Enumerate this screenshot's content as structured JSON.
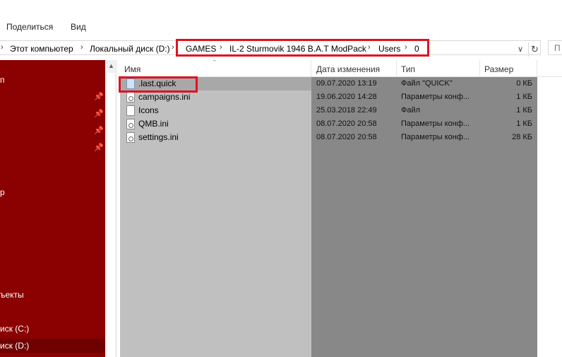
{
  "ribbon": {
    "share_label": "Поделиться",
    "view_label": "Вид"
  },
  "address": {
    "this_pc": "Этот компьютер",
    "local_disk": "Локальный диск (D:)",
    "path": [
      "GAMES",
      "IL-2 Sturmovik 1946 B.A.T ModPack",
      "Users",
      "0"
    ],
    "search_placeholder": "П"
  },
  "nav": {
    "items": [
      {
        "label": "п"
      },
      {
        "label": "р"
      },
      {
        "label": "ъекты"
      },
      {
        "label": "иск (C:)"
      },
      {
        "label": "иск (D:)"
      }
    ]
  },
  "columns": {
    "name": "Имя",
    "date": "Дата изменения",
    "type": "Тип",
    "size": "Размер"
  },
  "files": [
    {
      "name": ".last.quick",
      "date": "09.07.2020 13:19",
      "type": "Файл \"QUICK\"",
      "size": "0 КБ",
      "icon": "quick-file-icon"
    },
    {
      "name": "campaigns.ini",
      "date": "19.06.2020 14:28",
      "type": "Параметры конф...",
      "size": "1 КБ",
      "icon": "config-file-icon"
    },
    {
      "name": "Icons",
      "date": "25.03.2018 22:49",
      "type": "Файл",
      "size": "1 КБ",
      "icon": "file-icon"
    },
    {
      "name": "QMB.ini",
      "date": "08.07.2020 20:58",
      "type": "Параметры конф...",
      "size": "1 КБ",
      "icon": "config-file-icon"
    },
    {
      "name": "settings.ini",
      "date": "08.07.2020 20:58",
      "type": "Параметры конф...",
      "size": "28 КБ",
      "icon": "config-file-icon"
    }
  ],
  "colors": {
    "nav_background": "#8b0000",
    "highlight_outline": "#e0121f",
    "name_column_bg": "#c0c0c0",
    "detail_columns_bg": "#888888"
  }
}
